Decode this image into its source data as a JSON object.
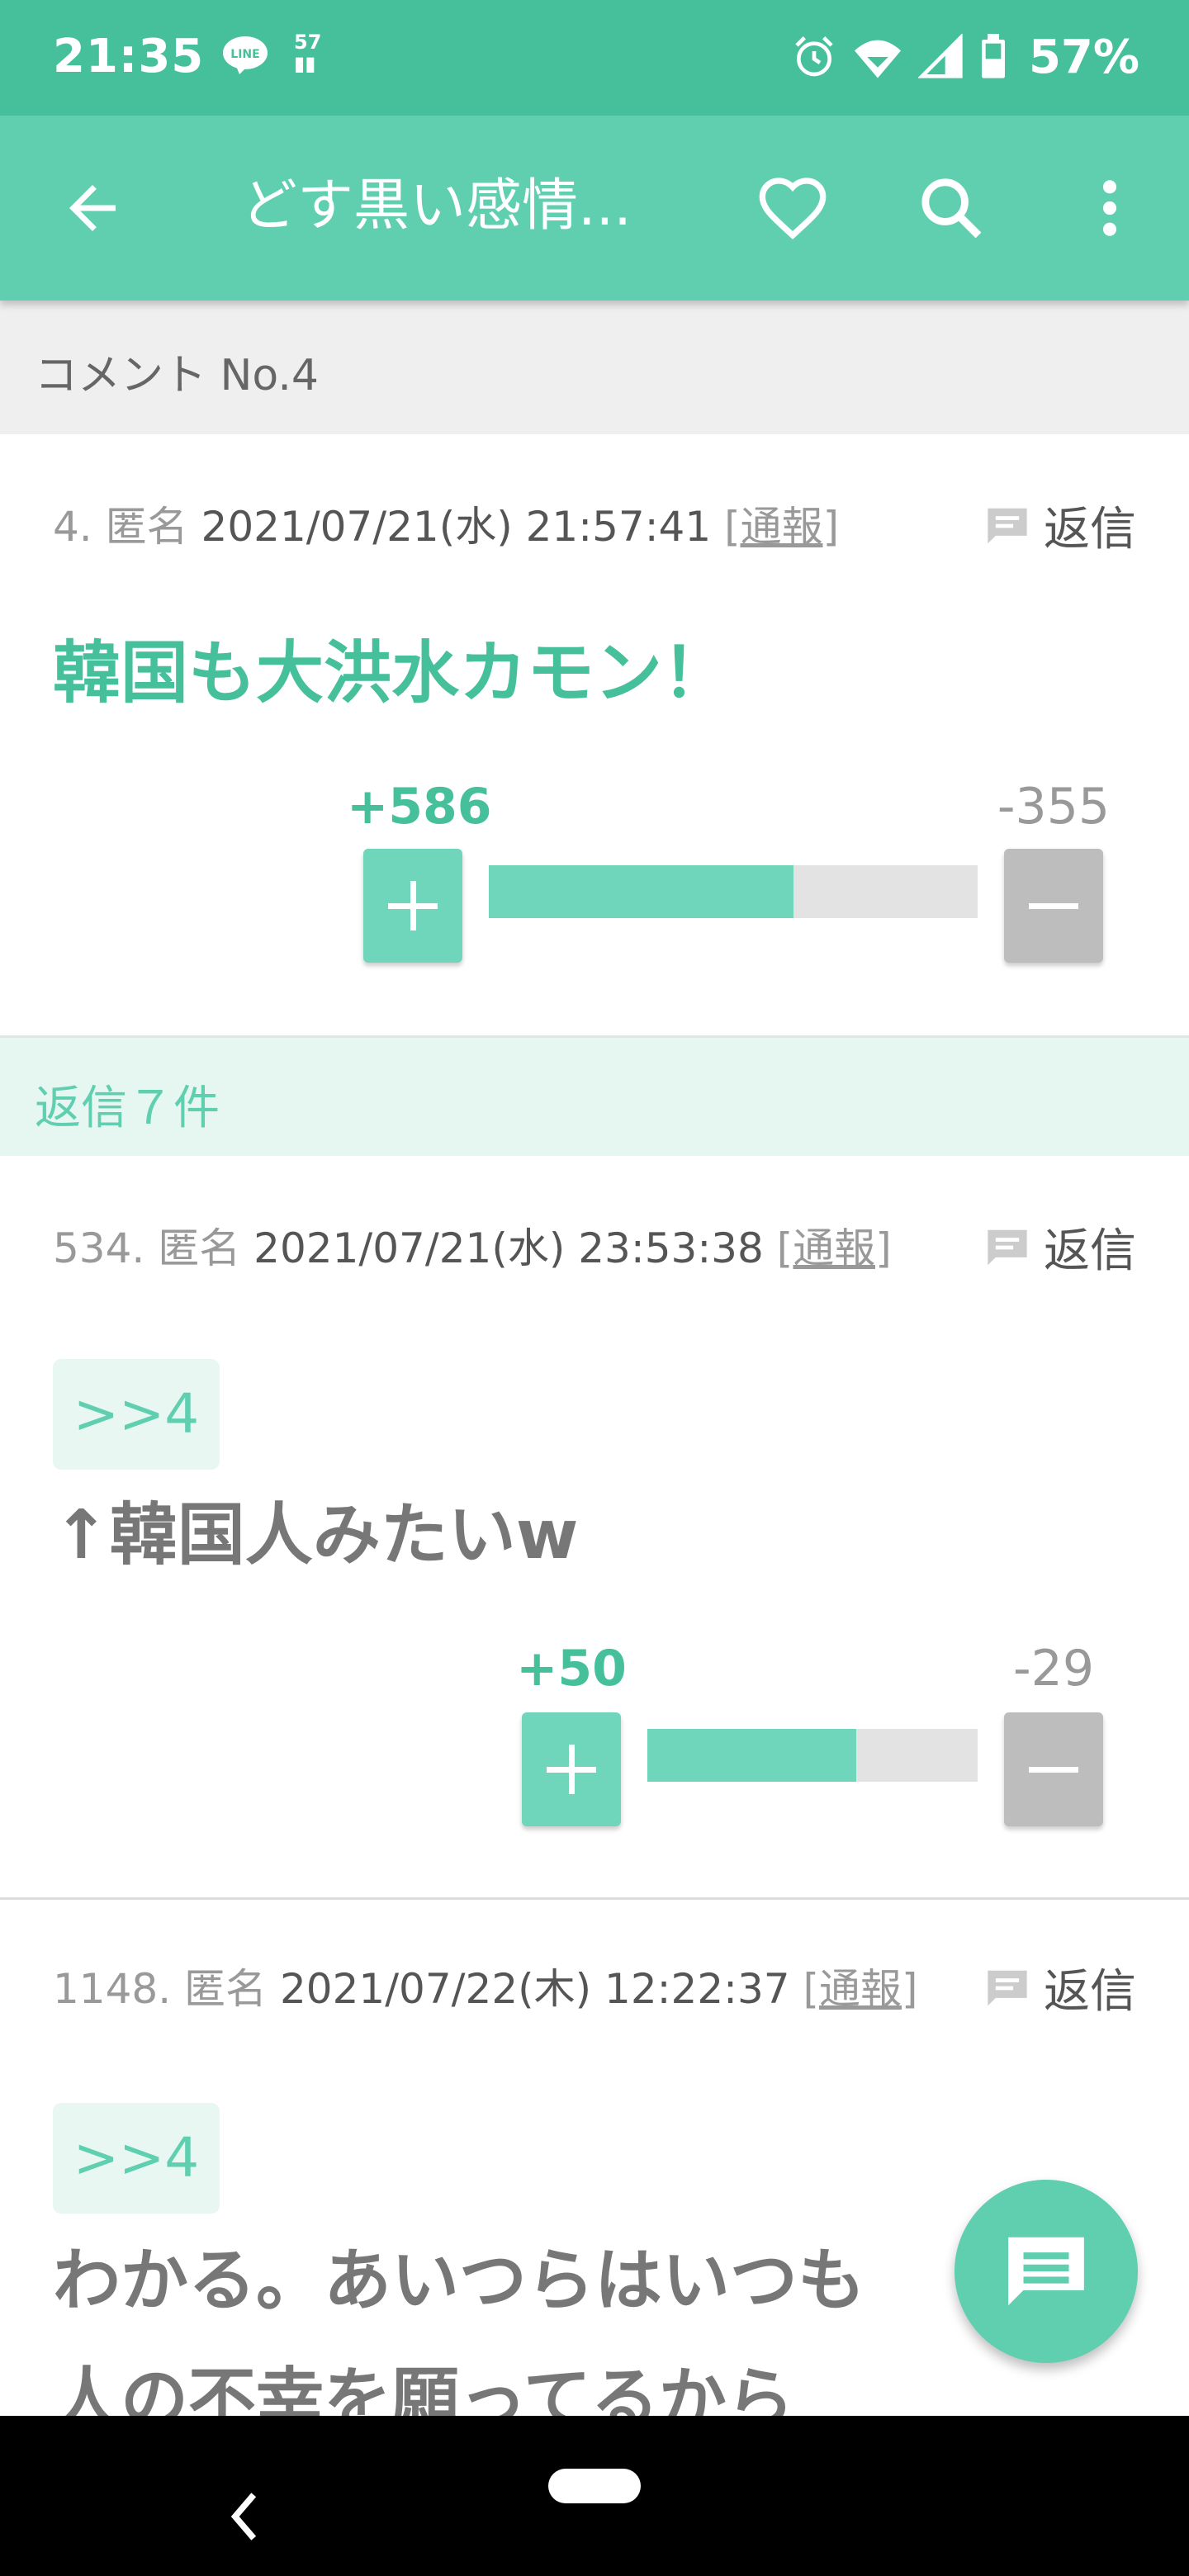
{
  "status_bar": {
    "time": "21:35",
    "line_badge": "LINE",
    "data_badge": "57",
    "battery_pct": "57%",
    "icons": [
      "line-icon",
      "data-usage-icon",
      "alarm-icon",
      "wifi-icon",
      "signal-icon",
      "battery-icon"
    ]
  },
  "app_bar": {
    "title": "どす黒い感情...",
    "icons": [
      "back-arrow-icon",
      "heart-icon",
      "search-icon",
      "more-vert-icon"
    ]
  },
  "comment_header": {
    "label": "コメント No.4"
  },
  "main_comment": {
    "number": "4.",
    "author": "匿名",
    "date": "2021/07/21(水) 21:57:41",
    "report": "[通報]",
    "reply_label": "返信",
    "body": "韓国も大洪水カモン！",
    "plus": "+586",
    "minus": "-355",
    "plus_ratio": 0.623
  },
  "replies_header": {
    "label": "返信７件"
  },
  "replies": [
    {
      "number": "534.",
      "author": "匿名",
      "date": "2021/07/21(水) 23:53:38",
      "report": "[通報]",
      "reply_label": "返信",
      "anchor": ">>4",
      "body": "↑韓国人みたいw",
      "plus": "+50",
      "minus": "-29",
      "plus_ratio": 0.633
    },
    {
      "number": "1148.",
      "author": "匿名",
      "date": "2021/07/22(木) 12:22:37",
      "report": "[通報]",
      "reply_label": "返信",
      "anchor": ">>4",
      "body_line1": "わかる。あいつらはいつも",
      "body_line2": "人の不幸を願ってるから"
    }
  ],
  "fab": {
    "icon": "comment-icon"
  },
  "nav_bar": {
    "icons": [
      "nav-back-icon",
      "nav-home-pill"
    ]
  },
  "colors": {
    "primary": "#5fcfb0",
    "status": "#46c09b",
    "minus": "#bdbdbd"
  }
}
